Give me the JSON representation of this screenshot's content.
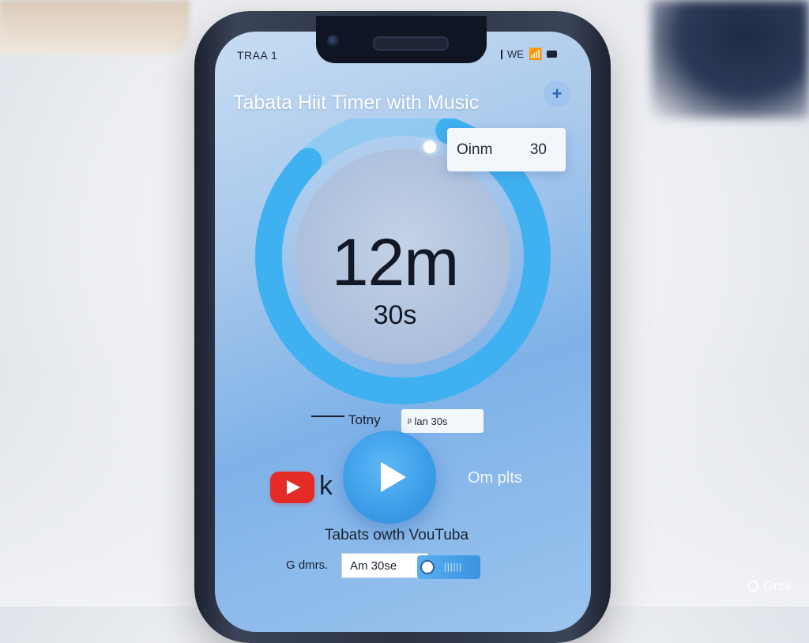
{
  "status_bar": {
    "left_text": "TRAA 1",
    "right_text": "WE"
  },
  "app": {
    "title": "Tabata Hiit Timer with Music",
    "add_icon": "+"
  },
  "timer": {
    "minutes_text": "12m",
    "seconds_text": "30s",
    "progress_fraction": 0.82,
    "tooltip": {
      "left": "Oinm",
      "right": "30"
    }
  },
  "total": {
    "label": "Totny",
    "value": "ᵖ lan 30s"
  },
  "music": {
    "side_text": "k",
    "label": "Om plts",
    "caption": "Tabats owth VouTuba"
  },
  "bottom": {
    "left_label": "G dmrs.",
    "input_value": "Am 30se",
    "toggle_text": "||||||"
  },
  "watermark": "Grok",
  "colors": {
    "accent": "#3a9ce8",
    "ring": "#3fb1f0",
    "youtube": "#e42b25"
  }
}
